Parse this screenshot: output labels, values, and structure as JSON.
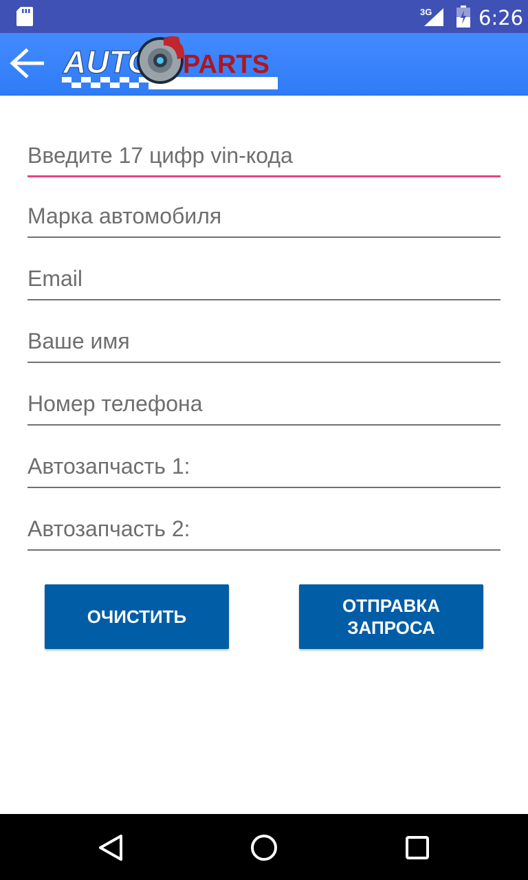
{
  "status_bar": {
    "network": "3G",
    "time": "6:26"
  },
  "app_bar": {
    "logo_text_left": "AUTO",
    "logo_text_right": "PARTS",
    "logo_colors": {
      "auto_text": "#ffffff",
      "parts_text": "#b0161e",
      "caliper": "#c0262c",
      "disc": "#9aa3aa"
    }
  },
  "form": {
    "fields": [
      {
        "placeholder": "Введите 17 цифр vin-кода",
        "value": ""
      },
      {
        "placeholder": "Марка автомобиля",
        "value": ""
      },
      {
        "placeholder": "Email",
        "value": ""
      },
      {
        "placeholder": "Ваше имя",
        "value": ""
      },
      {
        "placeholder": "Номер телефона",
        "value": ""
      },
      {
        "placeholder": "Автозапчасть 1:",
        "value": ""
      },
      {
        "placeholder": "Автозапчасть 2:",
        "value": ""
      }
    ],
    "clear_label": "ОЧИСТИТЬ",
    "send_label": "ОТПРАВКА\nЗАПРОСА"
  },
  "colors": {
    "status_bar": "#3f51b5",
    "app_bar": "#448aff",
    "focused_underline": "#e5447f",
    "button": "#005da6"
  },
  "icons": {
    "status": [
      "sd-card-icon",
      "signal-icon",
      "battery-icon"
    ],
    "app_bar": [
      "arrow-back-icon"
    ],
    "navigation": [
      "nav-back-icon",
      "nav-home-icon",
      "nav-recents-icon"
    ]
  }
}
